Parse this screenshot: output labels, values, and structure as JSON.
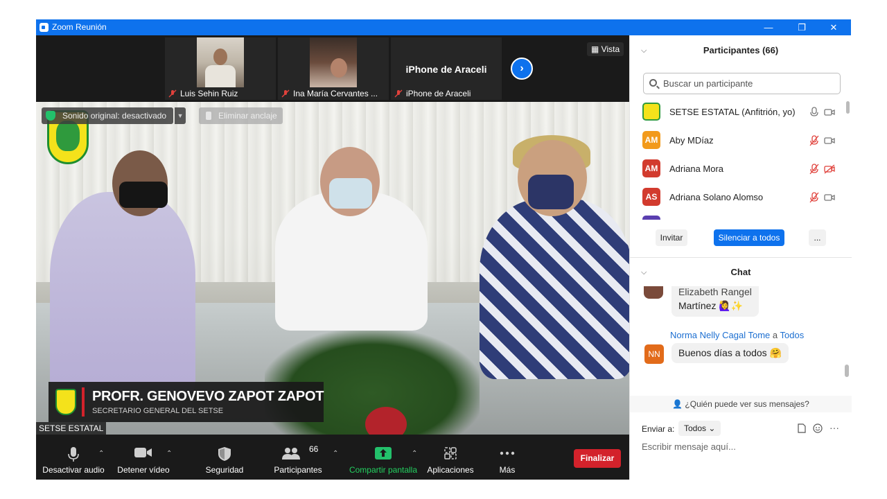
{
  "window": {
    "title": "Zoom Reunión",
    "minimize": "—",
    "restore": "❐",
    "close": "✕"
  },
  "strip": {
    "thumbs": [
      {
        "name": "Luis Sehin Ruiz"
      },
      {
        "name": "Ina María Cervantes ..."
      },
      {
        "name": "iPhone de Araceli",
        "big_name": "iPhone de Araceli"
      }
    ],
    "next": "›",
    "view_label": "Vista"
  },
  "video": {
    "audio_pill": "Sonido original: desactivado",
    "unpin": "Eliminar anclaje",
    "caption_name": "PROFR. GENOVEVO ZAPOT ZAPOT",
    "caption_role": "SECRETARIO GENERAL DEL SETSE",
    "speaker": "SETSE ESTATAL"
  },
  "toolbar": {
    "mute": "Desactivar audio",
    "video": "Detener vídeo",
    "security": "Seguridad",
    "participants": "Participantes",
    "participants_count": "66",
    "share": "Compartir pantalla",
    "apps": "Aplicaciones",
    "more": "Más",
    "end": "Finalizar"
  },
  "participants": {
    "header": "Participantes (66)",
    "search_placeholder": "Buscar un participante",
    "rows": [
      {
        "name": "SETSE ESTATAL (Anfitrión, yo)",
        "initials": "",
        "color": "#f4e21b"
      },
      {
        "name": "Aby MDíaz",
        "initials": "AM",
        "color": "#f29a1b"
      },
      {
        "name": "Adriana Mora",
        "initials": "AM",
        "color": "#d23b2e"
      },
      {
        "name": "Adriana Solano Alomso",
        "initials": "AS",
        "color": "#d23b2e"
      }
    ],
    "invite": "Invitar",
    "mute_all": "Silenciar a todos",
    "more": "..."
  },
  "chat": {
    "header": "Chat",
    "msg1_line1": "Elizabeth Rangel",
    "msg1_line2": "Martínez 🙋‍♀️✨",
    "sender2": "Norma Nelly Cagal Tome",
    "sender2_to": "a",
    "sender2_target": "Todos",
    "avatar2": "NN",
    "msg2": "Buenos días a todos 🤗",
    "who_sees": "¿Quién puede ver sus mensajes?",
    "send_to_label": "Enviar a:",
    "send_to_value": "Todos ⌄",
    "input_placeholder": "Escribir mensaje aquí...",
    "more": "···"
  }
}
